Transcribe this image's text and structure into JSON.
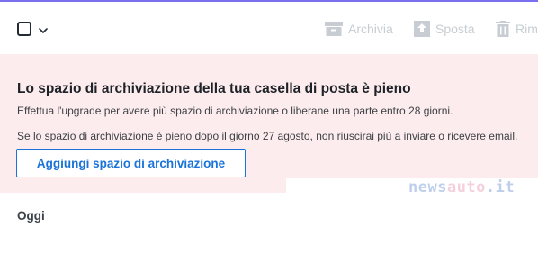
{
  "toolbar": {
    "actions": [
      {
        "label": "Archivia",
        "icon": "archive-icon"
      },
      {
        "label": "Sposta",
        "icon": "move-icon"
      },
      {
        "label": "Rim",
        "icon": "delete-icon"
      }
    ],
    "disabled_color": "#c7cdd2"
  },
  "banner": {
    "title": "Lo spazio di archiviazione della tua casella di posta è pieno",
    "line1": "Effettua l'upgrade per avere più spazio di archiviazione o liberane una parte entro 28 giorni.",
    "line2": "Se lo spazio di archiviazione è pieno dopo il giorno 27 agosto, non riuscirai più a inviare o ricevere email.",
    "button_label": "Aggiungi spazio di archiviazione",
    "background": "#fdeced",
    "accent": "#1a73d9"
  },
  "watermark": {
    "part1": "news",
    "part2": "auto",
    "part3": ".it"
  },
  "list": {
    "section_header": "Oggi"
  }
}
